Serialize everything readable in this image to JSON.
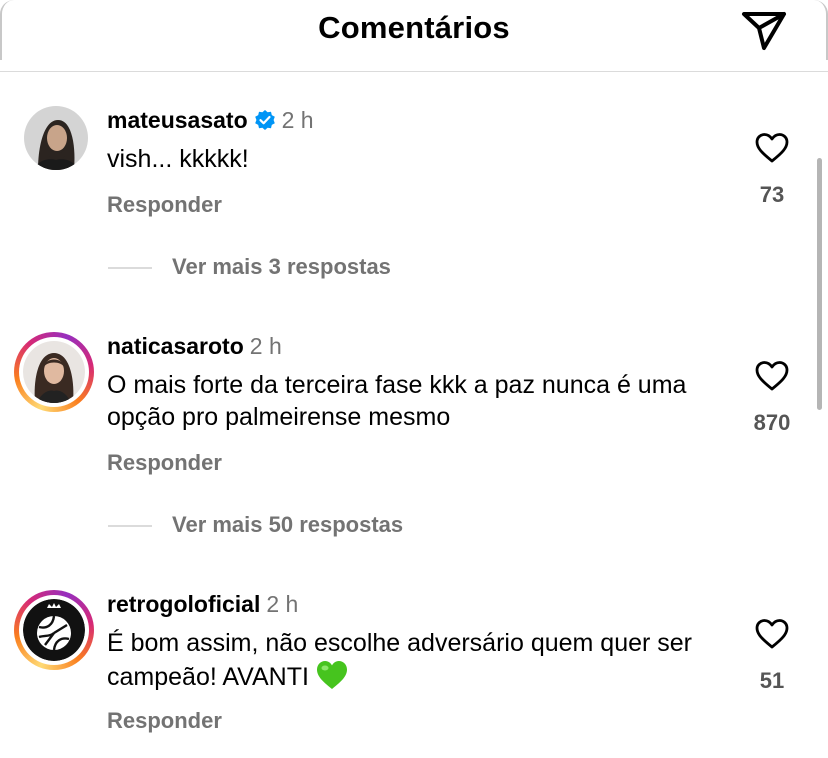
{
  "header": {
    "title": "Comentários",
    "send_icon": "paper-plane-icon"
  },
  "comments": [
    {
      "username": "mateusasato",
      "verified": true,
      "time": "2 h",
      "text": "vish... kkkkk!",
      "reply_label": "Responder",
      "likes": "73",
      "view_replies": "Ver mais 3 respostas"
    },
    {
      "username": "naticasaroto",
      "verified": false,
      "time": "2 h",
      "text": "O mais forte da terceira fase kkk a paz nunca é uma opção pro palmeirense mesmo",
      "reply_label": "Responder",
      "likes": "870",
      "view_replies": "Ver mais 50 respostas"
    },
    {
      "username": "retrogoloficial",
      "verified": false,
      "time": "2 h",
      "text": "É bom assim, não escolhe adversário quem quer ser campeão! AVANTI",
      "reply_label": "Responder",
      "likes": "51"
    }
  ],
  "colors": {
    "secondary_text": "#737373",
    "verified_badge": "#0095f6",
    "emoji_heart": "#46c41e",
    "divider": "#dbdbdb"
  }
}
